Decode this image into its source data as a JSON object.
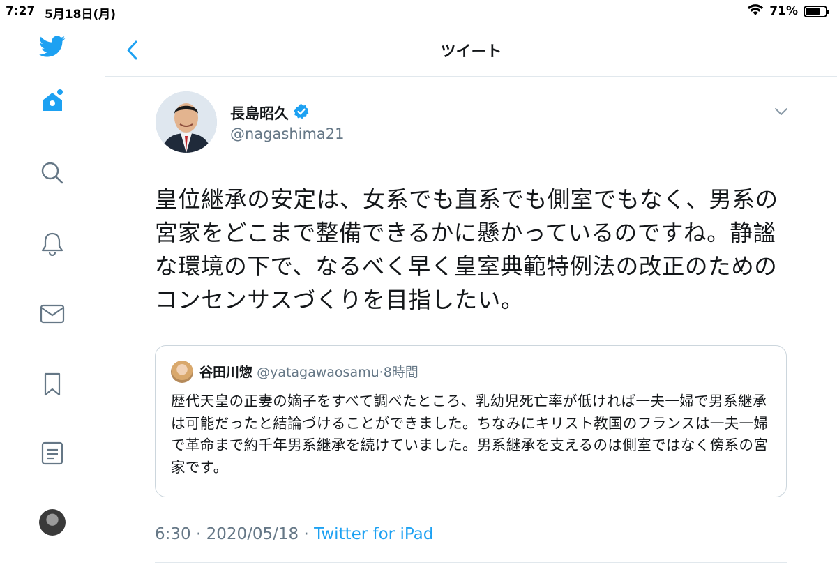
{
  "status_bar": {
    "time": "7:27",
    "date": "5月18日(月)",
    "battery_text": "71%",
    "battery_level": 0.71
  },
  "sidebar": {
    "items": [
      {
        "icon": "twitter-logo-icon"
      },
      {
        "icon": "home-icon"
      },
      {
        "icon": "search-icon"
      },
      {
        "icon": "bell-icon"
      },
      {
        "icon": "mail-icon"
      },
      {
        "icon": "bookmark-icon"
      },
      {
        "icon": "list-icon"
      },
      {
        "icon": "profile-avatar"
      }
    ]
  },
  "header": {
    "title": "ツイート"
  },
  "tweet": {
    "author_name": "長島昭久",
    "author_handle": "@nagashima21",
    "verified": true,
    "text": "皇位継承の安定は、女系でも直系でも側室でもなく、男系の宮家をどこまで整備できるかに懸かっているのですね。静謐な環境の下で、なるべく早く皇室典範特例法の改正のためのコンセンサスづくりを目指したい。",
    "time": "6:30",
    "date": "2020/05/18",
    "source": "Twitter for iPad"
  },
  "quote": {
    "author_name": "谷田川惣",
    "author_handle": "@yatagawaosamu",
    "age": "8時間",
    "text": "歴代天皇の正妻の嫡子をすべて調べたところ、乳幼児死亡率が低ければ一夫一婦で男系継承は可能だったと結論づけることができました。ちなみにキリスト教国のフランスは一夫一婦で革命まで約千年男系継承を続けていました。男系継承を支えるのは側室ではなく傍系の宮家です。"
  },
  "colors": {
    "accent": "#1da1f2",
    "text": "#14171a",
    "secondary": "#657786",
    "border": "#e1e8ed"
  }
}
